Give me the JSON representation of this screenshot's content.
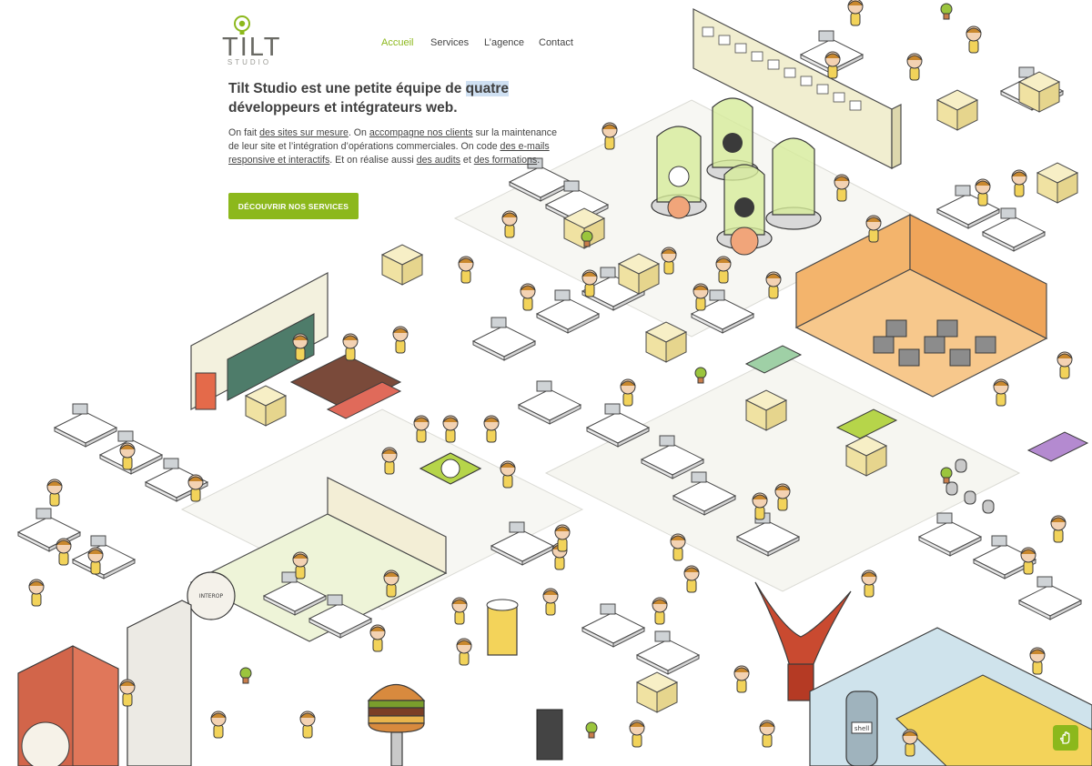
{
  "brand": {
    "name": "TILT",
    "subtitle": "STUDIO",
    "accent_color": "#8cb81c"
  },
  "nav": {
    "items": [
      {
        "label": "Accueil",
        "active": true
      },
      {
        "label": "Services",
        "active": false
      },
      {
        "label": "L’agence",
        "active": false
      },
      {
        "label": "Contact",
        "active": false
      }
    ]
  },
  "intro": {
    "headline_before": "Tilt Studio est une petite équipe de ",
    "headline_highlight": "quatre",
    "headline_after": " développeurs et intégrateurs web.",
    "p1": "On fait ",
    "link_sites": "des sites sur mesure",
    "p2": ". On ",
    "link_clients": "accompagne nos clients",
    "p3": " sur la maintenance de leur site et l’intégration d’opérations commerciales. On code ",
    "link_emails": "des e-mails responsive et interactifs",
    "p4": ". Et on réalise aussi ",
    "link_audits": "des audits",
    "p5": " et ",
    "link_formations": "des formations",
    "p6": "."
  },
  "cta": {
    "label": "DÉCOUVRIR NOS SERVICES"
  },
  "scene": {
    "signs": {
      "interop": "INTEROP",
      "shell": "shell"
    }
  },
  "help": {
    "icon": "hand-icon"
  }
}
